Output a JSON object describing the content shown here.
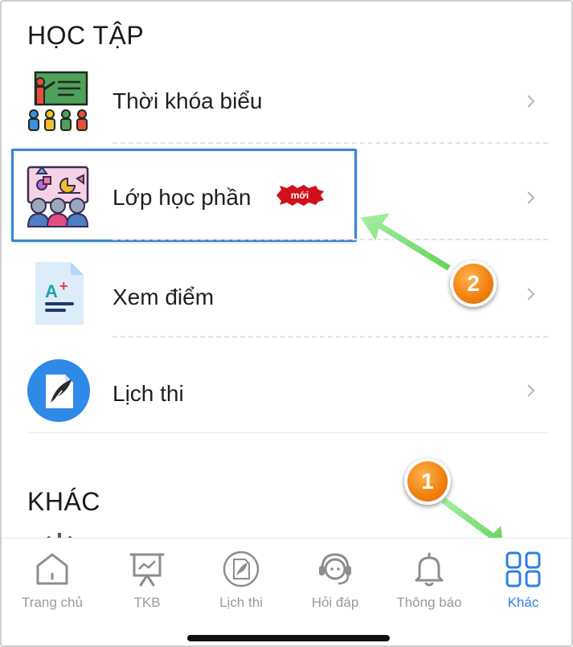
{
  "sections": {
    "hoc_tap": "HỌC TẬP",
    "khac": "KHÁC"
  },
  "menu": {
    "items": [
      {
        "label": "Thời khóa biểu",
        "icon": "teacher-board-icon"
      },
      {
        "label": "Lớp học phần",
        "icon": "class-group-icon",
        "badge": "mới"
      },
      {
        "label": "Xem điểm",
        "icon": "grade-sheet-icon"
      },
      {
        "label": "Lịch thi",
        "icon": "feather-document-icon"
      }
    ]
  },
  "annotations": {
    "step1": "1",
    "step2": "2"
  },
  "tabbar": {
    "tabs": [
      {
        "label": "Trang chủ",
        "icon": "home-icon"
      },
      {
        "label": "TKB",
        "icon": "chart-board-icon"
      },
      {
        "label": "Lịch thi",
        "icon": "exam-document-icon"
      },
      {
        "label": "Hỏi đáp",
        "icon": "headset-support-icon"
      },
      {
        "label": "Thông báo",
        "icon": "bell-icon"
      },
      {
        "label": "Khác",
        "icon": "grid-icon",
        "active": true
      }
    ]
  },
  "colors": {
    "accent": "#2f7fe3",
    "highlight_border": "#3b86d8",
    "arrow": "#7ee07a",
    "step_badge": "#f07f0c",
    "new_tag": "#d0101b"
  }
}
